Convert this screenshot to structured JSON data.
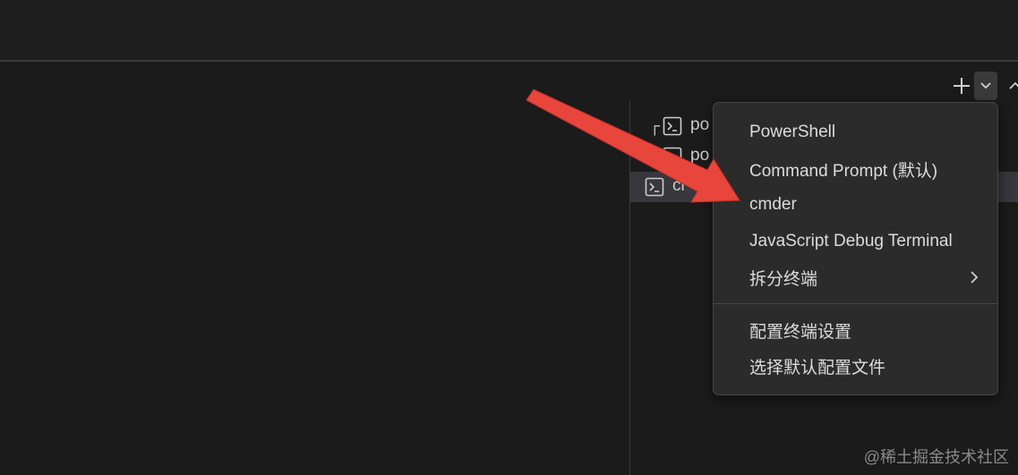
{
  "toolbar": {
    "new_terminal_icon": "plus-icon",
    "profiles_dropdown_icon": "chevron-down-icon",
    "maximize_icon": "chevron-up-icon"
  },
  "terminal_tabs": [
    {
      "tree_glyph": "┌",
      "label": "po",
      "icon": "terminal-icon",
      "active": false
    },
    {
      "tree_glyph": "",
      "label": "po",
      "icon": "terminal-icon",
      "active": false
    },
    {
      "tree_glyph": "",
      "label": "cl",
      "icon": "terminal-icon",
      "active": true
    }
  ],
  "profiles_menu": {
    "items": [
      {
        "label": "PowerShell"
      },
      {
        "label": "Command Prompt (默认)"
      },
      {
        "label": "cmder"
      },
      {
        "label": "JavaScript Debug Terminal"
      },
      {
        "label": "拆分终端",
        "has_submenu": true
      }
    ],
    "footer_items": [
      {
        "label": "配置终端设置"
      },
      {
        "label": "选择默认配置文件"
      }
    ]
  },
  "annotation": {
    "arrow_color": "#e8453c"
  },
  "watermark": "@稀土掘金技术社区",
  "colors": {
    "background": "#1f1f1f",
    "menu_background": "#2b2b2b",
    "menu_text": "#dcdcdc",
    "active_tab": "#37373d"
  }
}
